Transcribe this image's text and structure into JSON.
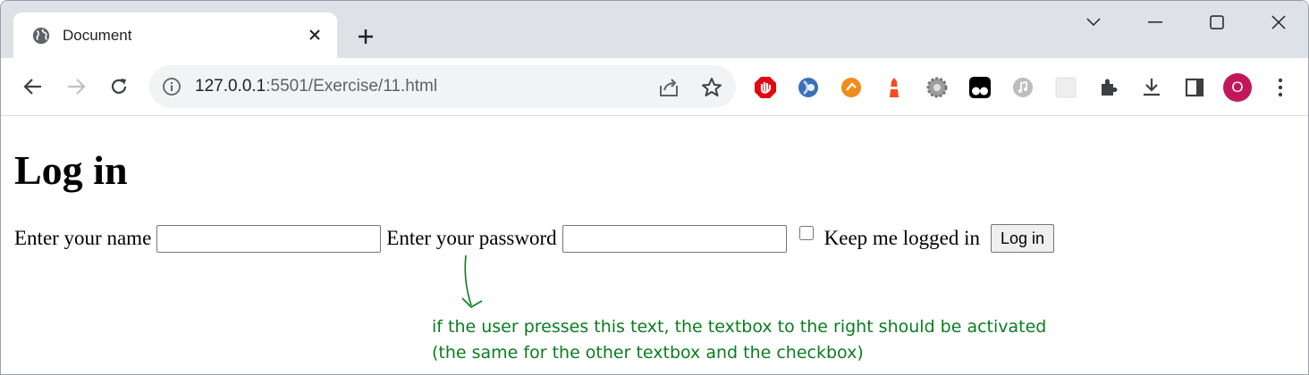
{
  "tab": {
    "title": "Document"
  },
  "omnibox": {
    "url_host": "127.0.0.1",
    "url_path": ":5501/Exercise/11.html"
  },
  "profile": {
    "initial": "O",
    "color": "#c2185b"
  },
  "page": {
    "heading": "Log in",
    "name_label": "Enter your name",
    "name_value": "",
    "password_label": "Enter your password",
    "password_value": "",
    "checkbox_label": "Keep me logged in",
    "checkbox_checked": false,
    "button_label": "Log in"
  },
  "annotation": {
    "line1": "if the user presses this text, the textbox to the right should be activated",
    "line2": "(the same for the other textbox and the checkbox)",
    "color": "#0a7d1e"
  },
  "extensions": [
    "ublock-icon",
    "vpn-icon",
    "feedly-icon",
    "lighthouse-icon",
    "settings-gear-icon",
    "tampermonkey-icon",
    "music-icon",
    "puzzle-placeholder-icon"
  ]
}
